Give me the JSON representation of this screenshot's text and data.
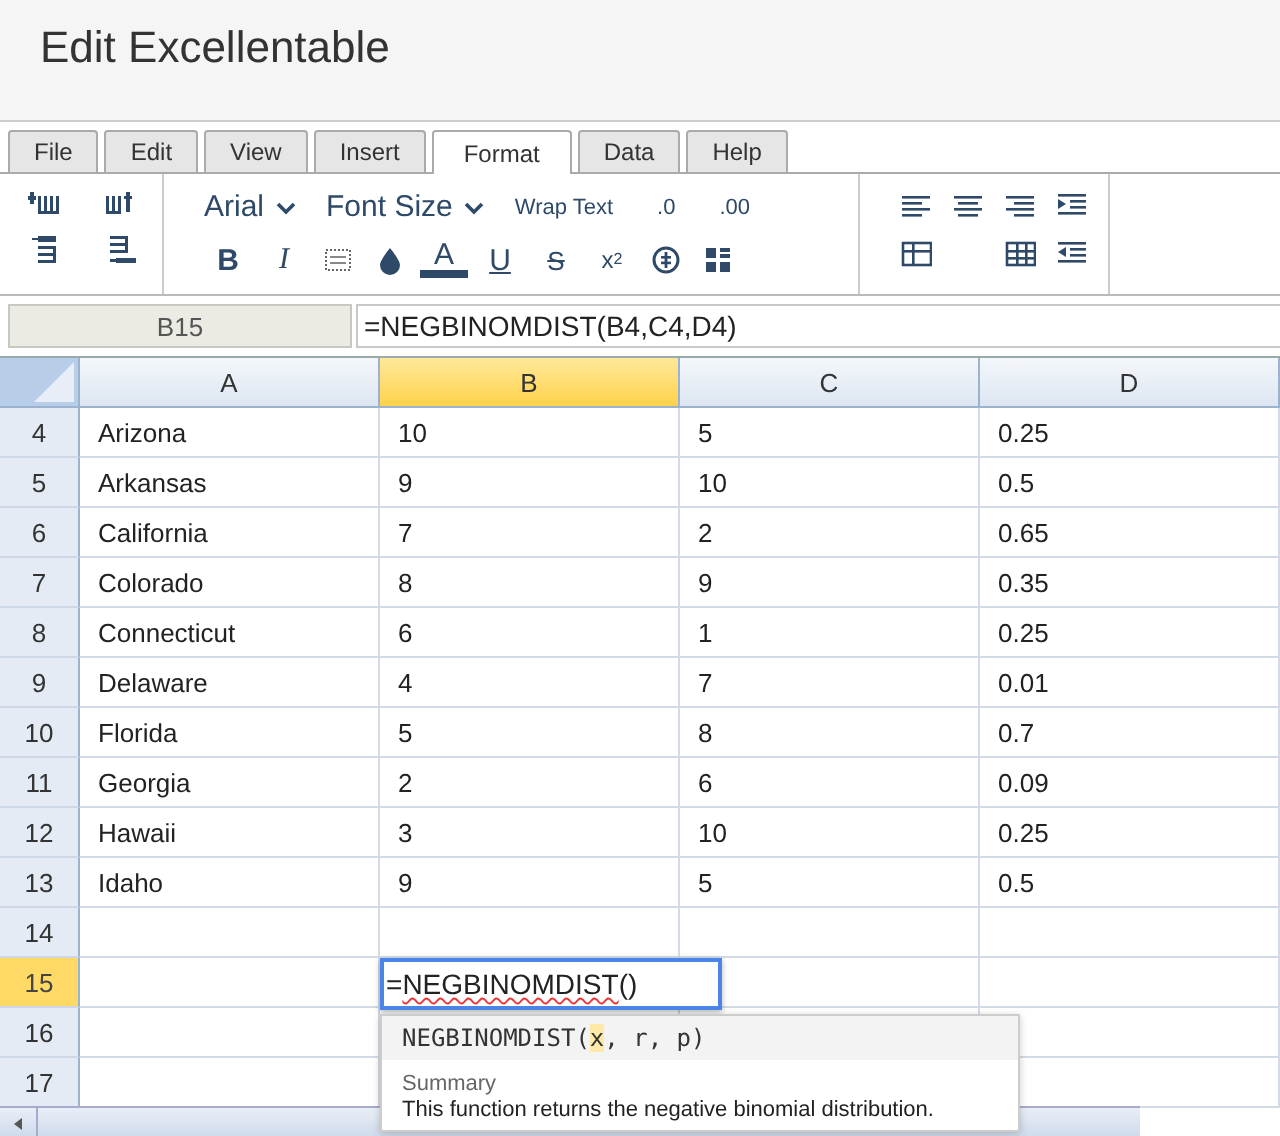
{
  "window": {
    "title": "Edit Excellentable"
  },
  "tabs": [
    {
      "label": "File",
      "selected": false
    },
    {
      "label": "Edit",
      "selected": false
    },
    {
      "label": "View",
      "selected": false
    },
    {
      "label": "Insert",
      "selected": false
    },
    {
      "label": "Format",
      "selected": true
    },
    {
      "label": "Data",
      "selected": false
    },
    {
      "label": "Help",
      "selected": false
    }
  ],
  "ribbon": {
    "font": "Arial",
    "font_size": "Font Size",
    "wrap_text": "Wrap Text",
    "decimals": [
      ".0",
      ".00"
    ],
    "format_buttons": [
      "B",
      "I",
      "A",
      "U",
      "S",
      "x$^{2}$"
    ]
  },
  "formula_bar": {
    "name_box": "B15",
    "formula": "=NEGBINOMDIST(B4,C4,D4)"
  },
  "grid": {
    "columns": [
      {
        "label": "A",
        "selected": false
      },
      {
        "label": "B",
        "selected": true
      },
      {
        "label": "C",
        "selected": false
      },
      {
        "label": "D",
        "selected": false
      }
    ],
    "rows": [
      {
        "header": "4",
        "selected": false,
        "cells": [
          "Arizona",
          "10",
          "5",
          "0.25"
        ]
      },
      {
        "header": "5",
        "selected": false,
        "cells": [
          "Arkansas",
          "9",
          "10",
          "0.5"
        ]
      },
      {
        "header": "6",
        "selected": false,
        "cells": [
          "California",
          "7",
          "2",
          "0.65"
        ]
      },
      {
        "header": "7",
        "selected": false,
        "cells": [
          "Colorado",
          "8",
          "9",
          "0.35"
        ]
      },
      {
        "header": "8",
        "selected": false,
        "cells": [
          "Connecticut",
          "6",
          "1",
          "0.25"
        ]
      },
      {
        "header": "9",
        "selected": false,
        "cells": [
          "Delaware",
          "4",
          "7",
          "0.01"
        ]
      },
      {
        "header": "10",
        "selected": false,
        "cells": [
          "Florida",
          "5",
          "8",
          "0.7"
        ]
      },
      {
        "header": "11",
        "selected": false,
        "cells": [
          "Georgia",
          "2",
          "6",
          "0.09"
        ]
      },
      {
        "header": "12",
        "selected": false,
        "cells": [
          "Hawaii",
          "3",
          "10",
          "0.25"
        ]
      },
      {
        "header": "13",
        "selected": false,
        "cells": [
          "Idaho",
          "9",
          "5",
          "0.5"
        ]
      },
      {
        "header": "14",
        "selected": false
      },
      {
        "header": "15",
        "selected": true
      },
      {
        "header": "16",
        "selected": false
      },
      {
        "header": "17",
        "selected": false
      }
    ],
    "editor": {
      "value_prefix": "=",
      "value_function": "NEGBINOMDIST",
      "value_suffix": "()"
    },
    "tooltip": {
      "function": "NEGBINOMDIST(",
      "params": [
        {
          "text": "x",
          "selected": true
        },
        {
          "text": "r",
          "selected": false
        },
        {
          "text": "p",
          "selected": false
        }
      ],
      "separator": ", ",
      "close": ")",
      "summary_label": "Summary",
      "summary": "This function returns the negative binomial distribution."
    }
  }
}
